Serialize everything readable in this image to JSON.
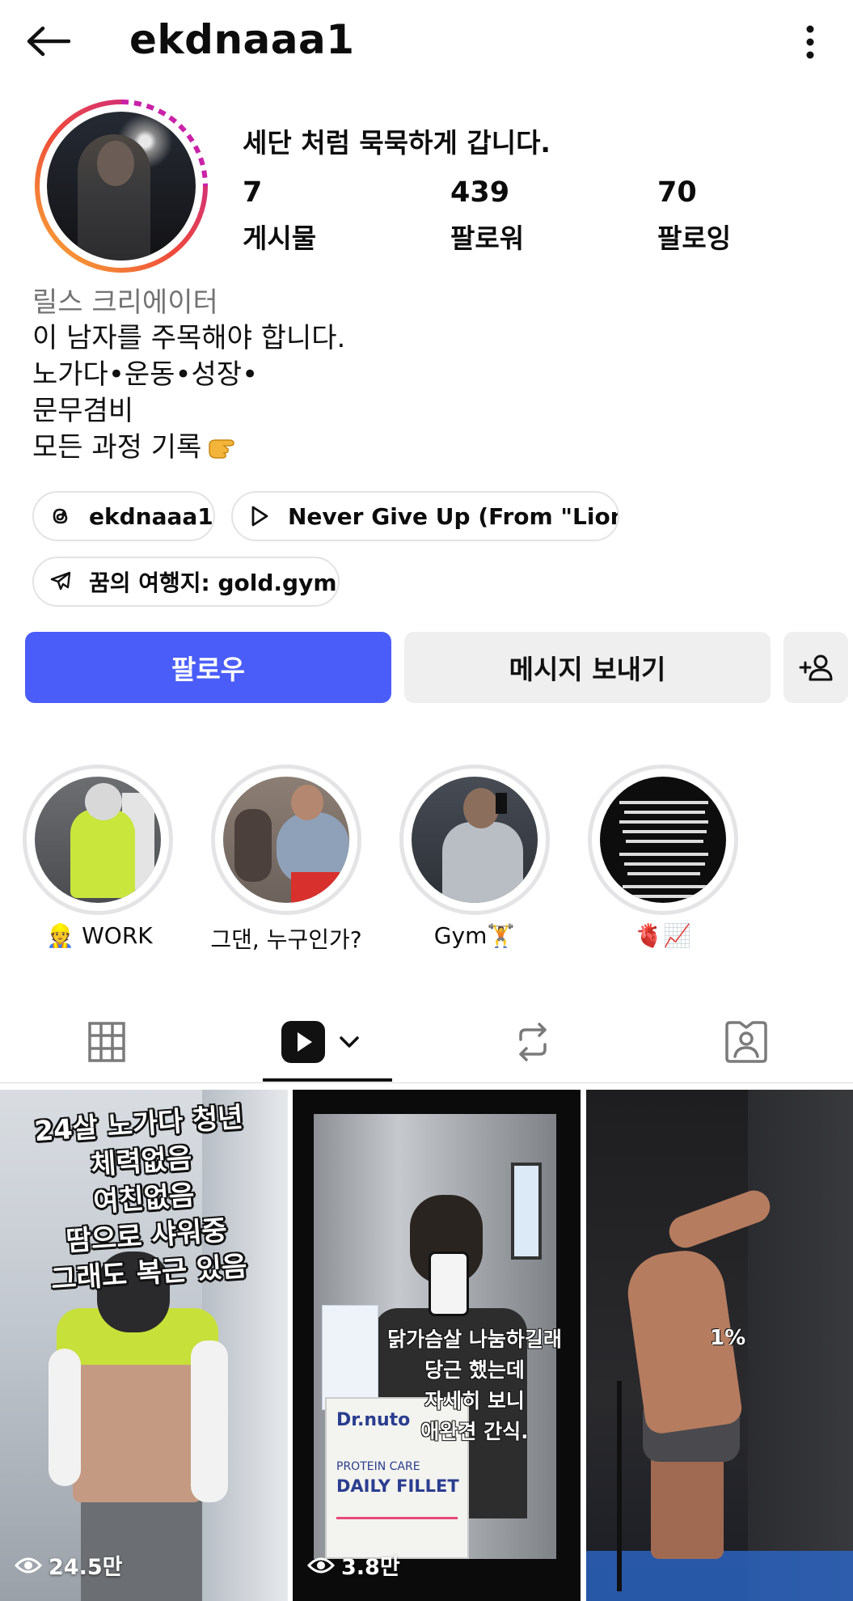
{
  "header": {
    "username": "ekdnaaa1"
  },
  "profile": {
    "headline": "세단 처럼 묵묵하게 갑니다.",
    "stats": [
      {
        "value": "7",
        "label": "게시물"
      },
      {
        "value": "439",
        "label": "팔로워"
      },
      {
        "value": "70",
        "label": "팔로잉"
      }
    ],
    "category": "릴스 크리에이터",
    "bio": [
      "이 남자를 주목해야 합니다.",
      "노가다•운동•성장•",
      "문무겸비",
      "모든 과정 기록"
    ],
    "bio_emoji": "pointing-hand-emoji"
  },
  "chips": {
    "threads": "ekdnaaa1",
    "music": "Never Give Up (From \"Lion...",
    "travel": "꿈의 여행지: gold.gym"
  },
  "actions": {
    "follow": "팔로우",
    "message": "메시지 보내기"
  },
  "highlights": [
    {
      "label": "👷 WORK"
    },
    {
      "label": "그댄, 누구인가?"
    },
    {
      "label": "Gym🏋"
    },
    {
      "label": "🫀📈"
    }
  ],
  "tabs": [
    "grid",
    "reels",
    "reposts",
    "tagged"
  ],
  "active_tab": "reels",
  "reels": [
    {
      "overlay": [
        "24살 노가다 청년",
        "체력없음",
        "여친없음",
        "땀으로 샤워중",
        "그래도 복근 있음"
      ],
      "views": "24.5만"
    },
    {
      "overlay": [
        "닭가슴살 나눔하길래",
        "당근 했는데",
        "자세히 보니",
        "애완견 간식."
      ],
      "views": "3.8만",
      "package": {
        "brand": "Dr.nuto",
        "line1": "PROTEIN CARE",
        "line2": "DAILY FILLET"
      }
    },
    {
      "overlay": [
        "1%"
      ]
    }
  ],
  "colors": {
    "accent": "#4a5df9",
    "button_secondary": "#efefef",
    "muted_text": "#737373"
  }
}
